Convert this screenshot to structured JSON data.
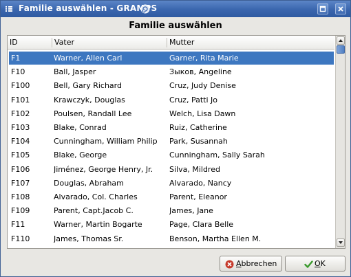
{
  "window": {
    "title": "Familie auswählen - GRAMPS",
    "accent": "#3a66ae"
  },
  "dialog": {
    "heading": "Familie auswählen"
  },
  "table": {
    "columns": [
      "ID",
      "Vater",
      "Mutter"
    ],
    "selected_index": 0,
    "selection_color": "#3d77c0",
    "rows": [
      {
        "id": "F1",
        "vater": "Warner, Allen Carl",
        "mutter": "Garner, Rita Marie"
      },
      {
        "id": "F10",
        "vater": "Ball, Jasper",
        "mutter": "Зыков, Angeline"
      },
      {
        "id": "F100",
        "vater": "Bell, Gary Richard",
        "mutter": "Cruz, Judy Denise"
      },
      {
        "id": "F101",
        "vater": "Krawczyk, Douglas",
        "mutter": "Cruz, Patti Jo"
      },
      {
        "id": "F102",
        "vater": "Poulsen, Randall Lee",
        "mutter": "Welch, Lisa Dawn"
      },
      {
        "id": "F103",
        "vater": "Blake, Conrad",
        "mutter": "Ruiz, Catherine"
      },
      {
        "id": "F104",
        "vater": "Cunningham, William Philip",
        "mutter": "Park, Susannah"
      },
      {
        "id": "F105",
        "vater": "Blake, George",
        "mutter": "Cunningham, Sally Sarah"
      },
      {
        "id": "F106",
        "vater": "Jiménez, George Henry, Jr.",
        "mutter": "Silva, Mildred"
      },
      {
        "id": "F107",
        "vater": "Douglas, Abraham",
        "mutter": "Alvarado, Nancy"
      },
      {
        "id": "F108",
        "vater": "Alvarado, Col. Charles",
        "mutter": "Parent, Eleanor"
      },
      {
        "id": "F109",
        "vater": "Parent, Capt.Jacob C.",
        "mutter": "James, Jane"
      },
      {
        "id": "F11",
        "vater": "Warner, Martin Bogarte",
        "mutter": "Page, Clara Belle"
      },
      {
        "id": "F110",
        "vater": "James, Thomas Sr.",
        "mutter": "Benson, Martha Ellen M."
      }
    ]
  },
  "buttons": {
    "cancel": {
      "mnemonic": "A",
      "rest": "bbrechen",
      "icon": "cancel-x-icon"
    },
    "ok": {
      "mnemonic": "O",
      "rest": "K",
      "icon": "checkmark-icon"
    }
  },
  "icons": {
    "window_menu": "window-menu-icon",
    "title_decor": "gramps-swirl-icon",
    "maximize": "maximize-icon",
    "close": "close-icon",
    "scroll_up": "scroll-up-arrow-icon",
    "scroll_down": "scroll-down-arrow-icon"
  }
}
